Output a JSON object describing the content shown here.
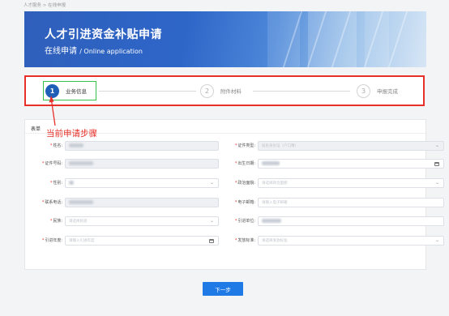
{
  "breadcrumb": "人才服务 > 在线申报",
  "banner": {
    "title": "人才引进资金补贴申请",
    "subtitle_cn": "在线申请",
    "subtitle_en": "/ Online application"
  },
  "steps": [
    {
      "number": "1",
      "label": "业务信息",
      "state": "active"
    },
    {
      "number": "2",
      "label": "附件材料",
      "state": "idle"
    },
    {
      "number": "3",
      "label": "申报完成",
      "state": "idle"
    }
  ],
  "annotation": {
    "text": "当前申请步骤",
    "color": "#e8302a"
  },
  "form": {
    "title": "表单",
    "fields": {
      "name": {
        "label": "姓名:"
      },
      "id_type": {
        "label": "证件类型:",
        "value": "居民身份证（户口簿）",
        "icon": "chevron-down-icon"
      },
      "id_number": {
        "label": "证件号码:"
      },
      "birth_date": {
        "label": "出生日期:",
        "icon": "calendar-icon"
      },
      "gender": {
        "label": "性别:",
        "icon": "chevron-down-icon"
      },
      "political_status": {
        "label": "政治面貌:",
        "placeholder": "请选择政治面貌",
        "icon": "chevron-down-icon"
      },
      "phone": {
        "label": "联系电话:"
      },
      "email": {
        "label": "电子邮箱:",
        "placeholder": "请输入电子邮箱"
      },
      "ethnicity": {
        "label": "民族:",
        "placeholder": "请选择民族",
        "icon": "chevron-down-icon"
      },
      "employer": {
        "label": "引进单位:"
      },
      "intro_year": {
        "label": "引进年度:",
        "placeholder": "请输入引进年度",
        "icon": "calendar-icon"
      },
      "standard": {
        "label": "发放标准:",
        "placeholder": "请选择发放标准",
        "icon": "chevron-down-icon"
      }
    }
  },
  "next_button": "下一步",
  "colors": {
    "primary": "#1f7ae6",
    "step_active": "#1f5fb8",
    "highlight": "#35c24d",
    "annotation": "#e8302a"
  }
}
